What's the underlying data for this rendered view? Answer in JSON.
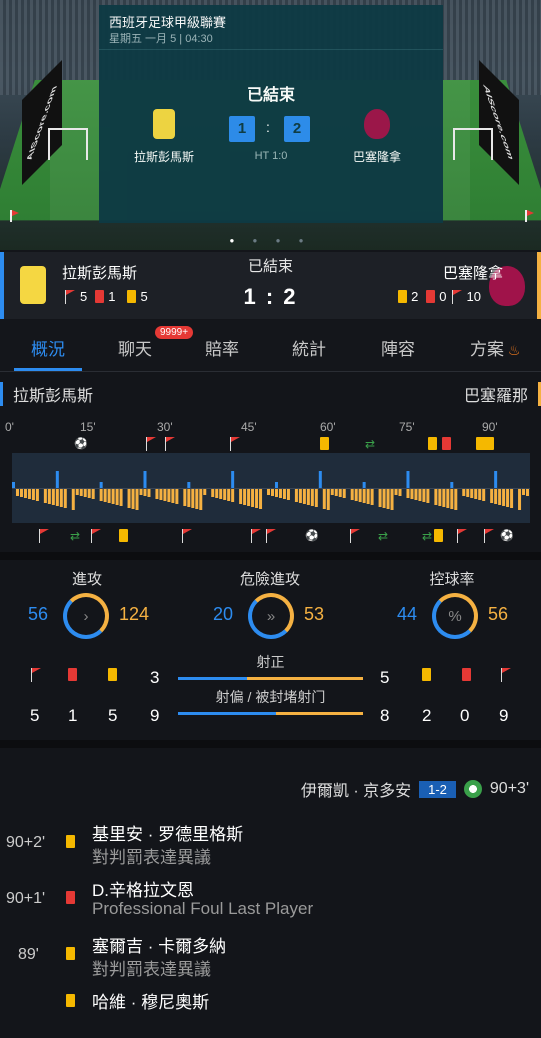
{
  "carousel": {
    "league": "西班牙足球甲級聯賽",
    "date": "星期五 一月 5 | 04:30",
    "status": "已結束",
    "home_score": "1",
    "away_score": "2",
    "score_separator": ":",
    "halftime": "HT 1:0",
    "home_team": "拉斯彭馬斯",
    "away_team": "巴塞隆拿",
    "ad_text_left": "AIScore.com",
    "ad_text_right": "AIScore.com",
    "page_indicator": "● ● ● ●"
  },
  "header": {
    "status": "已結束",
    "score": "1 : 2",
    "home_team": "拉斯彭馬斯",
    "away_team": "巴塞隆拿",
    "home_corners": "5",
    "home_reds": "1",
    "home_yellows": "5",
    "away_yellows": "2",
    "away_reds": "0",
    "away_corners": "10"
  },
  "tabs": [
    {
      "label": "概況",
      "active": true
    },
    {
      "label": "聊天",
      "badge": "9999+"
    },
    {
      "label": "賠率"
    },
    {
      "label": "統計"
    },
    {
      "label": "陣容"
    },
    {
      "label": "方案",
      "icon": "fire-icon"
    }
  ],
  "team_row": {
    "home": "拉斯彭馬斯",
    "away": "巴塞羅那"
  },
  "timeline": {
    "ticks": [
      "0'",
      "15'",
      "30'",
      "45'",
      "60'",
      "75'",
      "90'"
    ]
  },
  "stats": {
    "attack": {
      "label": "進攻",
      "home": "56",
      "away": "124"
    },
    "dangerous": {
      "label": "危險進攻",
      "home": "20",
      "away": "53"
    },
    "possession": {
      "label": "控球率",
      "home": "44",
      "away": "56",
      "symbol": "%"
    },
    "on_target": {
      "label": "射正",
      "home": "3",
      "away": "5"
    },
    "off_target": {
      "label": "射偏 / 被封堵射门",
      "home": "9",
      "away": "8"
    },
    "home_corners": "5",
    "home_reds": "1",
    "home_yellows": "5",
    "away_yellows": "2",
    "away_reds": "0",
    "away_corners": "9"
  },
  "events": {
    "goal_player": "伊爾凱 · 京多安",
    "goal_score": "1-2",
    "goal_time": "90+3'",
    "items": [
      {
        "time": "90+2'",
        "card": "yellow",
        "player": "基里安 · 罗德里格斯",
        "desc": "對判罰表達異議"
      },
      {
        "time": "90+1'",
        "card": "red",
        "player": "D.辛格拉文恩",
        "desc": "Professional Foul Last Player"
      },
      {
        "time": "89'",
        "card": "yellow",
        "player": "塞爾吉 · 卡爾多納",
        "desc": "對判罰表達異議"
      },
      {
        "time": "",
        "card": "yellow",
        "player": "哈維 · 穆尼奧斯",
        "desc": ""
      }
    ]
  },
  "colors": {
    "home": "#2d8cf0",
    "away": "#f5b142",
    "red": "#e53935",
    "yellow": "#f5b800"
  }
}
